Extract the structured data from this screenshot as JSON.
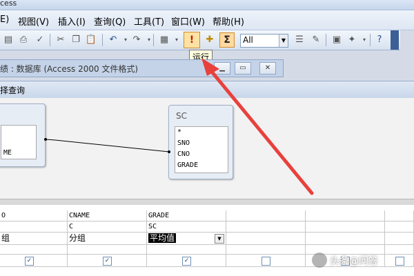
{
  "window": {
    "title": "cess"
  },
  "menu": [
    "E)",
    "视图(V)",
    "插入(I)",
    "查询(Q)",
    "工具(T)",
    "窗口(W)",
    "帮助(H)"
  ],
  "toolbar": {
    "combo_value": "All",
    "run_label": "!",
    "sigma_label": "Σ",
    "tooltip": "运行",
    "icons": [
      "new-icon",
      "print-icon",
      "preview-icon",
      "spell-icon",
      "cut-icon",
      "copy-icon",
      "paste-icon",
      "undo-icon",
      "redo-icon",
      "view-icon",
      "run-icon",
      "show-table-icon",
      "totals-icon",
      "properties-icon",
      "build-icon",
      "database-window-icon",
      "new-object-icon",
      "help-icon"
    ]
  },
  "db_window": {
    "title": "绩 : 数据库 (Access 2000 文件格式)"
  },
  "query": {
    "title": "择查询"
  },
  "tables": [
    {
      "name": "",
      "fields": [
        "",
        "",
        "ME"
      ]
    },
    {
      "name": "SC",
      "fields": [
        "*",
        "SNO",
        "CNO",
        "GRADE"
      ]
    }
  ],
  "grid": {
    "field_row": [
      "O",
      "CNAME",
      "GRADE",
      "",
      "",
      ""
    ],
    "table_row": [
      "",
      "C",
      "SC",
      "",
      "",
      ""
    ],
    "total_row": [
      "组",
      "分组",
      "平均值",
      "",
      "",
      ""
    ],
    "show_row": [
      true,
      true,
      true,
      false,
      false,
      false
    ]
  },
  "watermark": "头条@问答",
  "colors": {
    "arrow": "#e8413c",
    "accent": "#3c5f96"
  }
}
